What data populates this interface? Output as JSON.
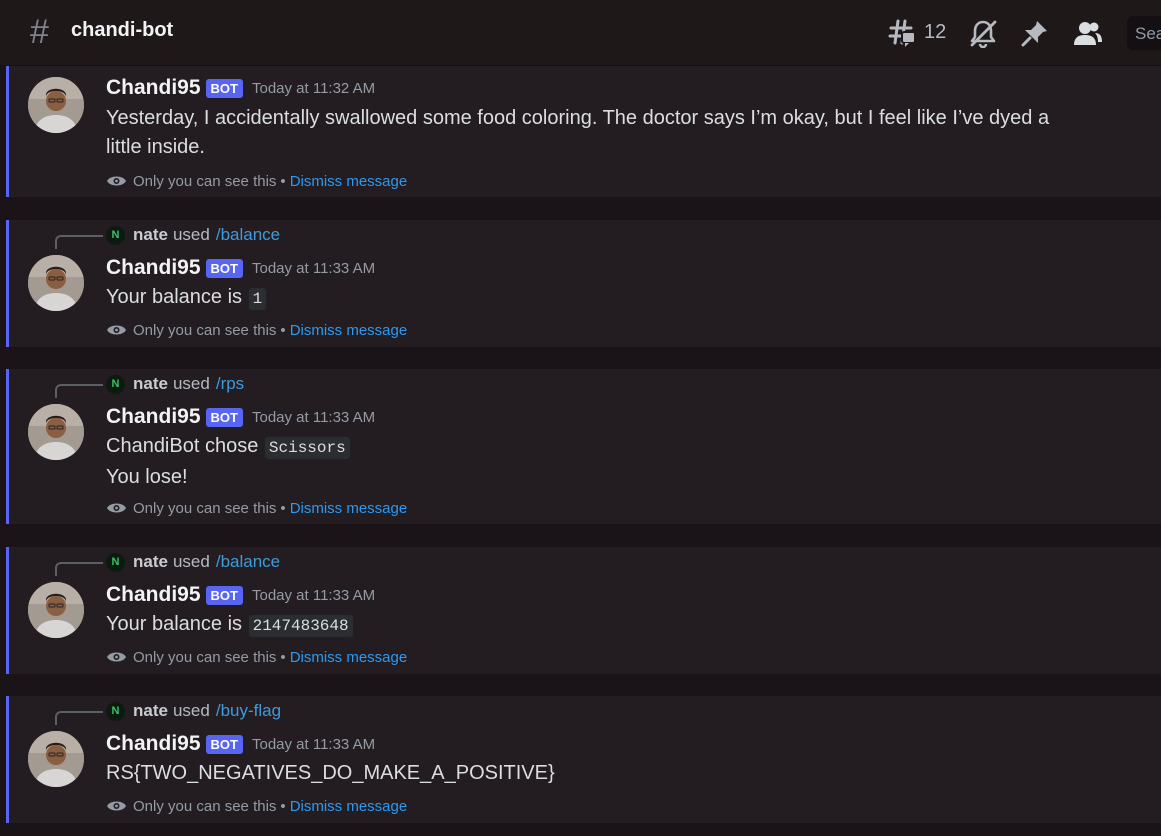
{
  "channel": {
    "hash_symbol": "#",
    "name": "chandi-bot",
    "thread_count": "12",
    "search_placeholder": "Search"
  },
  "messages": [
    {
      "replied": null,
      "author": "Chandi95",
      "bot_badge": "BOT",
      "timestamp": "Today at 11:32 AM",
      "text_lines": [
        "Yesterday, I accidentally swallowed some food coloring. The doctor says I’m okay, but I feel like I’ve dyed a little inside."
      ],
      "ephemeral_note": "Only you can see this",
      "separator": "•",
      "dismiss_label": "Dismiss message"
    },
    {
      "replied": {
        "user_initial": "N",
        "user": "nate",
        "verb": "used",
        "command": "/balance"
      },
      "author": "Chandi95",
      "bot_badge": "BOT",
      "timestamp": "Today at 11:33 AM",
      "text_prefix": "Your balance is",
      "code": "1",
      "ephemeral_note": "Only you can see this",
      "separator": "•",
      "dismiss_label": "Dismiss message"
    },
    {
      "replied": {
        "user_initial": "N",
        "user": "nate",
        "verb": "used",
        "command": "/rps"
      },
      "author": "Chandi95",
      "bot_badge": "BOT",
      "timestamp": "Today at 11:33 AM",
      "text_prefix": "ChandiBot chose",
      "code": "Scissors",
      "second_line": "You lose!",
      "ephemeral_note": "Only you can see this",
      "separator": "•",
      "dismiss_label": "Dismiss message"
    },
    {
      "replied": {
        "user_initial": "N",
        "user": "nate",
        "verb": "used",
        "command": "/balance"
      },
      "author": "Chandi95",
      "bot_badge": "BOT",
      "timestamp": "Today at 11:33 AM",
      "text_prefix": "Your balance is",
      "code": "2147483648",
      "ephemeral_note": "Only you can see this",
      "separator": "•",
      "dismiss_label": "Dismiss message"
    },
    {
      "replied": {
        "user_initial": "N",
        "user": "nate",
        "verb": "used",
        "command": "/buy-flag"
      },
      "author": "Chandi95",
      "bot_badge": "BOT",
      "timestamp": "Today at 11:33 AM",
      "text": "RS{TWO_NEGATIVES_DO_MAKE_A_POSITIVE}",
      "ephemeral_note": "Only you can see this",
      "separator": "•",
      "dismiss_label": "Dismiss message"
    }
  ],
  "icons": {
    "channel": "hash-icon",
    "threads": "threads-icon",
    "notifications": "muted-bell-icon",
    "pins": "pin-icon",
    "members": "members-icon",
    "ephemeral": "eye-icon"
  },
  "colors": {
    "accent": "#5865f2",
    "link": "#2b99f2",
    "command": "#3d9bdc"
  }
}
